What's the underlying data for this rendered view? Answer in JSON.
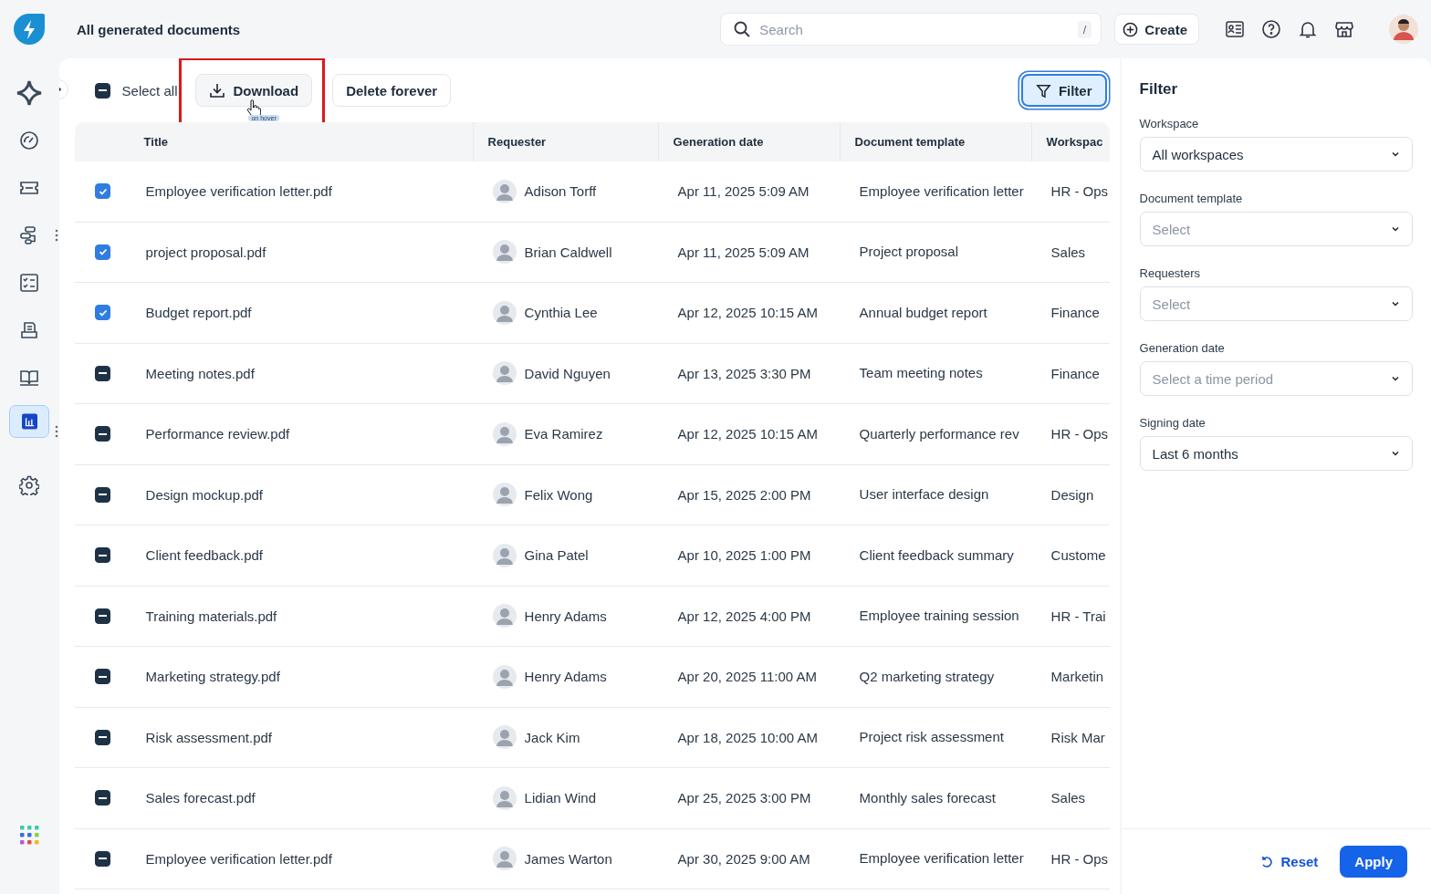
{
  "header": {
    "title": "All generated documents",
    "search": {
      "placeholder": "Search",
      "shortcut": "/"
    },
    "create_label": "Create"
  },
  "sidebar": {
    "items": [
      {
        "kind": "sparkle",
        "selected": false,
        "menu": false
      },
      {
        "kind": "gauge",
        "selected": false,
        "menu": false
      },
      {
        "kind": "ticket",
        "selected": false,
        "menu": false
      },
      {
        "kind": "flow",
        "selected": false,
        "menu": true
      },
      {
        "kind": "checklist",
        "selected": false,
        "menu": false
      },
      {
        "kind": "desk",
        "selected": false,
        "menu": false
      },
      {
        "kind": "book",
        "selected": false,
        "menu": false
      },
      {
        "kind": "chart",
        "selected": true,
        "menu": true
      },
      {
        "kind": "gear",
        "selected": false,
        "menu": false
      }
    ]
  },
  "toolbar": {
    "select_all": {
      "label": "Select all",
      "checked": true,
      "indeterminate": true
    },
    "download": "Download",
    "hover_note": "on hover",
    "delete": "Delete forever",
    "filter": "Filter"
  },
  "table": {
    "columns": [
      "Title",
      "Requester",
      "Generation date",
      "Document template",
      "Workspac"
    ],
    "rows": [
      {
        "checked": true,
        "indeterminate": false,
        "title": "Employee verification letter.pdf",
        "requester": "Adison Torff",
        "date": "Apr 11, 2025 5:09 AM",
        "template": "Employee verification letter",
        "workspace": "HR - Ops"
      },
      {
        "checked": true,
        "indeterminate": false,
        "title": "project proposal.pdf",
        "requester": "Brian Caldwell",
        "date": "Apr 11, 2025 5:09 AM",
        "template": "Project proposal",
        "workspace": "Sales"
      },
      {
        "checked": true,
        "indeterminate": false,
        "title": "Budget report.pdf",
        "requester": "Cynthia Lee",
        "date": "Apr 12, 2025 10:15 AM",
        "template": "Annual budget report",
        "workspace": "Finance"
      },
      {
        "checked": true,
        "indeterminate": true,
        "title": "Meeting notes.pdf",
        "requester": "David Nguyen",
        "date": "Apr 13, 2025 3:30 PM",
        "template": "Team meeting notes",
        "workspace": "Finance"
      },
      {
        "checked": true,
        "indeterminate": true,
        "title": "Performance review.pdf",
        "requester": "Eva Ramirez",
        "date": "Apr 12, 2025 10:15 AM",
        "template": "Quarterly performance rev",
        "workspace": "HR - Ops"
      },
      {
        "checked": true,
        "indeterminate": true,
        "title": "Design mockup.pdf",
        "requester": "Felix Wong",
        "date": "Apr 15, 2025 2:00 PM",
        "template": "User interface design",
        "workspace": "Design"
      },
      {
        "checked": true,
        "indeterminate": true,
        "title": "Client feedback.pdf",
        "requester": "Gina Patel",
        "date": "Apr 10, 2025 1:00 PM",
        "template": "Client feedback summary",
        "workspace": "Custome"
      },
      {
        "checked": true,
        "indeterminate": true,
        "title": "Training materials.pdf",
        "requester": "Henry Adams",
        "date": "Apr 12, 2025 4:00 PM",
        "template": "Employee training session",
        "workspace": "HR - Trai"
      },
      {
        "checked": true,
        "indeterminate": true,
        "title": "Marketing strategy.pdf",
        "requester": "Henry Adams",
        "date": "Apr 20, 2025 11:00 AM",
        "template": "Q2 marketing strategy",
        "workspace": "Marketin"
      },
      {
        "checked": true,
        "indeterminate": true,
        "title": "Risk assessment.pdf",
        "requester": "Jack Kim",
        "date": "Apr 18, 2025 10:00 AM",
        "template": "Project risk assessment",
        "workspace": "Risk Mar"
      },
      {
        "checked": true,
        "indeterminate": true,
        "title": "Sales forecast.pdf",
        "requester": "Lidian Wind",
        "date": "Apr 25, 2025 3:00 PM",
        "template": "Monthly sales forecast",
        "workspace": "Sales"
      },
      {
        "checked": true,
        "indeterminate": true,
        "title": "Employee verification letter.pdf",
        "requester": "James Warton",
        "date": "Apr 30, 2025 9:00 AM",
        "template": "Employee verification letter",
        "workspace": "HR - Ops"
      }
    ]
  },
  "filter_panel": {
    "title": "Filter",
    "fields": [
      {
        "label": "Workspace",
        "value": "All workspaces"
      },
      {
        "label": "Document template",
        "placeholder": "Select"
      },
      {
        "label": "Requesters",
        "placeholder": "Select"
      },
      {
        "label": "Generation date",
        "placeholder": "Select a time period"
      },
      {
        "label": "Signing date",
        "value": "Last 6 months"
      }
    ],
    "reset": "Reset",
    "apply": "Apply"
  }
}
